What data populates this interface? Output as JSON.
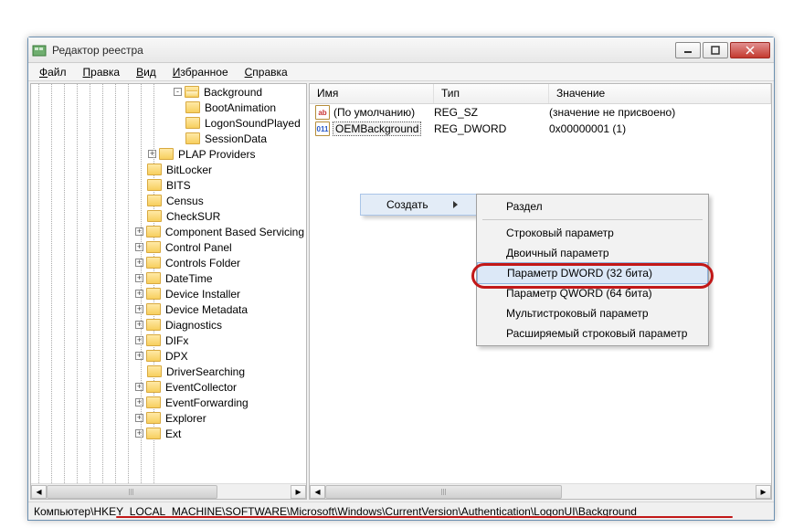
{
  "window": {
    "title": "Редактор реестра"
  },
  "menu": {
    "file": "Файл",
    "edit": "Правка",
    "view": "Вид",
    "favorites": "Избранное",
    "help": "Справка"
  },
  "columns": {
    "name": "Имя",
    "type": "Тип",
    "value": "Значение"
  },
  "tree": {
    "items": [
      {
        "indent": 156,
        "exp": "-",
        "open": true,
        "label": "Background"
      },
      {
        "indent": 156,
        "exp": "",
        "open": false,
        "label": "BootAnimation"
      },
      {
        "indent": 156,
        "exp": "",
        "open": false,
        "label": "LogonSoundPlayed"
      },
      {
        "indent": 156,
        "exp": "",
        "open": false,
        "label": "SessionData"
      },
      {
        "indent": 128,
        "exp": "+",
        "open": false,
        "label": "PLAP Providers"
      },
      {
        "indent": 114,
        "exp": "",
        "open": false,
        "label": "BitLocker"
      },
      {
        "indent": 114,
        "exp": "",
        "open": false,
        "label": "BITS"
      },
      {
        "indent": 114,
        "exp": "",
        "open": false,
        "label": "Census"
      },
      {
        "indent": 114,
        "exp": "",
        "open": false,
        "label": "CheckSUR"
      },
      {
        "indent": 114,
        "exp": "+",
        "open": false,
        "label": "Component Based Servicing"
      },
      {
        "indent": 114,
        "exp": "+",
        "open": false,
        "label": "Control Panel"
      },
      {
        "indent": 114,
        "exp": "+",
        "open": false,
        "label": "Controls Folder"
      },
      {
        "indent": 114,
        "exp": "+",
        "open": false,
        "label": "DateTime"
      },
      {
        "indent": 114,
        "exp": "+",
        "open": false,
        "label": "Device Installer"
      },
      {
        "indent": 114,
        "exp": "+",
        "open": false,
        "label": "Device Metadata"
      },
      {
        "indent": 114,
        "exp": "+",
        "open": false,
        "label": "Diagnostics"
      },
      {
        "indent": 114,
        "exp": "+",
        "open": false,
        "label": "DIFx"
      },
      {
        "indent": 114,
        "exp": "+",
        "open": false,
        "label": "DPX"
      },
      {
        "indent": 114,
        "exp": "",
        "open": false,
        "label": "DriverSearching"
      },
      {
        "indent": 114,
        "exp": "+",
        "open": false,
        "label": "EventCollector"
      },
      {
        "indent": 114,
        "exp": "+",
        "open": false,
        "label": "EventForwarding"
      },
      {
        "indent": 114,
        "exp": "+",
        "open": false,
        "label": "Explorer"
      },
      {
        "indent": 114,
        "exp": "+",
        "open": false,
        "label": "Ext"
      }
    ]
  },
  "values": [
    {
      "icon": "ab",
      "iconClass": "reg-sz",
      "name": "(По умолчанию)",
      "type": "REG_SZ",
      "val": "(значение не присвоено)",
      "selected": false
    },
    {
      "icon": "011",
      "iconClass": "reg-dw",
      "name": "OEMBackground",
      "type": "REG_DWORD",
      "val": "0x00000001 (1)",
      "selected": true
    }
  ],
  "context": {
    "create": "Создать",
    "sub": {
      "section": "Раздел",
      "string": "Строковый параметр",
      "binary": "Двоичный параметр",
      "dword": "Параметр DWORD (32 бита)",
      "qword": "Параметр QWORD (64 бита)",
      "multistring": "Мультистроковый параметр",
      "expandstring": "Расширяемый строковый параметр"
    }
  },
  "status": {
    "prefix": "Компьютер\\",
    "path": "HKEY_LOCAL_MACHINE\\SOFTWARE\\Microsoft\\Windows\\CurrentVersion\\Authentication\\LogonUI\\Background"
  }
}
